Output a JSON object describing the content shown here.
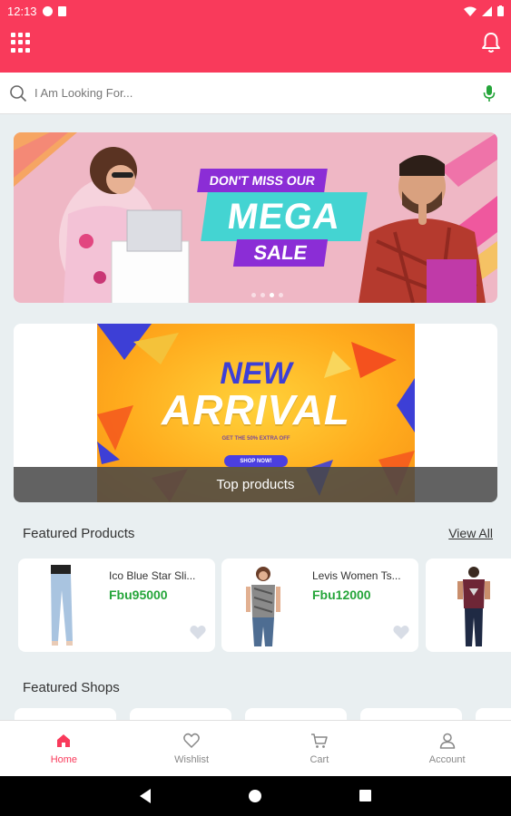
{
  "status_bar": {
    "time": "12:13"
  },
  "search": {
    "placeholder": "I Am Looking For..."
  },
  "banner": {
    "line1": "DON'T MISS OUR",
    "line2": "MEGA",
    "line3": "SALE",
    "active_dot": 3,
    "dot_count": 4
  },
  "top_products": {
    "banner_title_1": "NEW",
    "banner_title_2": "ARRIVAL",
    "banner_subtitle": "GET THE 50% EXTRA OFF",
    "banner_button": "SHOP NOW!",
    "label": "Top products"
  },
  "featured_products": {
    "title": "Featured Products",
    "view_all": "View All",
    "items": [
      {
        "name": "Ico Blue Star Sli...",
        "price": "Fbu95000"
      },
      {
        "name": "Levis Women Ts...",
        "price": "Fbu12000"
      },
      {
        "name": "",
        "price": ""
      }
    ]
  },
  "featured_shops": {
    "title": "Featured Shops"
  },
  "bottom_nav": {
    "items": [
      {
        "label": "Home",
        "icon": "home-icon"
      },
      {
        "label": "Wishlist",
        "icon": "heart-icon"
      },
      {
        "label": "Cart",
        "icon": "cart-icon"
      },
      {
        "label": "Account",
        "icon": "account-icon"
      }
    ]
  },
  "colors": {
    "primary": "#f93a5b",
    "price_green": "#25a53a",
    "background": "#e9eff1",
    "mic_green": "#25a53a"
  }
}
